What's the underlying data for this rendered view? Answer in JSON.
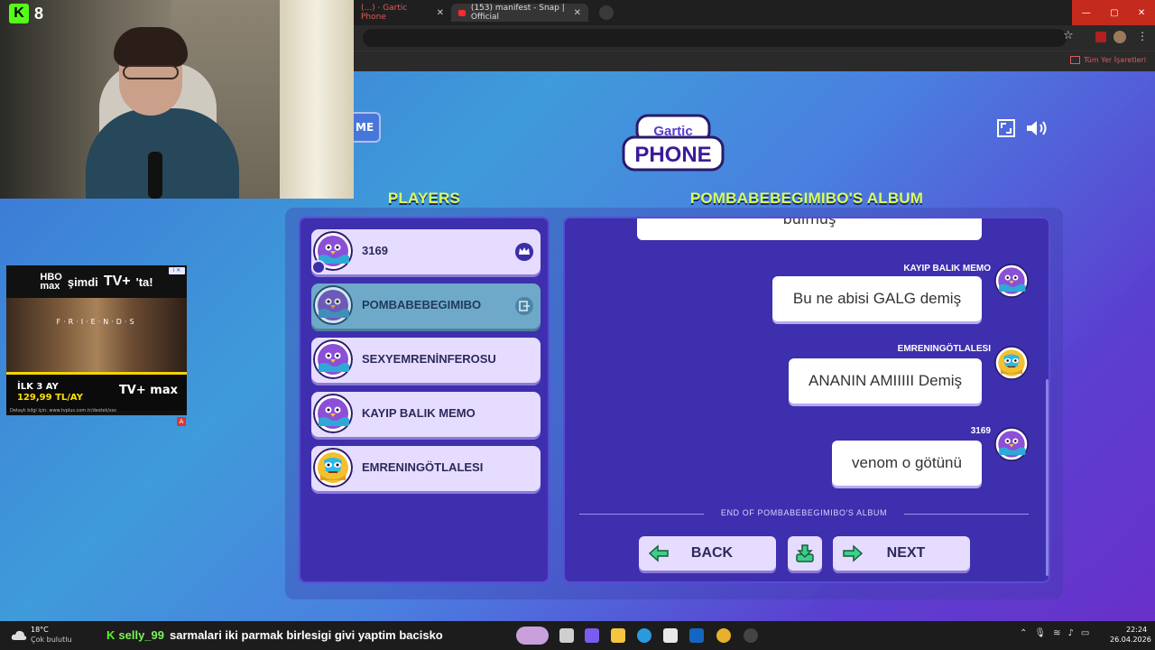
{
  "browser": {
    "tabs": [
      {
        "label": "(...) · Gartic Phone"
      },
      {
        "label": "(153) manifest - Snap | Official"
      }
    ],
    "bookmarks_label": "Tüm Yer İşaretleri"
  },
  "stream": {
    "kick_viewers": "8"
  },
  "ad": {
    "headline_brand": "max",
    "headline_text": "şimdi",
    "headline_tv": "TV+",
    "headline_suffix": "'ta!",
    "show_title": "F·R·I·E·N·D·S",
    "offer_line1": "İLK 3 AY",
    "offer_line2": "129,99 TL/AY",
    "brand": "TV+ max",
    "fine_print": "Detaylı bilgi için: www.tvplus.com.tr/destek/sss"
  },
  "game": {
    "home_label": "ME",
    "logo_top": "Gartic",
    "logo_main": "PHONE",
    "players_title": "PLAYERS",
    "album_title": "POMBABEBEGIMIBO'S ALBUM",
    "players": [
      {
        "name": "3169",
        "host": true
      },
      {
        "name": "POMBABEBEGIMIBO",
        "active": true
      },
      {
        "name": "SEXYEMRENİNFEROSU"
      },
      {
        "name": "KAYIP BALIK MEMO"
      },
      {
        "name": "EMRENINGÖTLALESI"
      }
    ],
    "album": {
      "top_partial": "bulmuş",
      "messages": [
        {
          "author": "KAYIP BALIK MEMO",
          "text": "Bu ne abisi GALG demiş"
        },
        {
          "author": "EMRENINGÖTLALESI",
          "text": "ANANIN AMIIIII Demiş"
        },
        {
          "author": "3169",
          "text": "venom o götünü"
        }
      ],
      "end_label": "END OF POMBABEBEGIMIBO'S ALBUM"
    },
    "buttons": {
      "back": "BACK",
      "next": "NEXT"
    }
  },
  "taskbar": {
    "weather_temp": "18°C",
    "weather_desc": "Çok bulutlu",
    "chat_user": "selly_99",
    "chat_message": "sarmalari iki parmak birlesigi givi yaptim bacisko",
    "time": "22:24",
    "date": "26.04.2026"
  },
  "colors": {
    "title_yellow": "#d8ff5c",
    "panel": "#3e2fae",
    "card": "#e6dcff",
    "active_card": "#6fa9c9"
  }
}
